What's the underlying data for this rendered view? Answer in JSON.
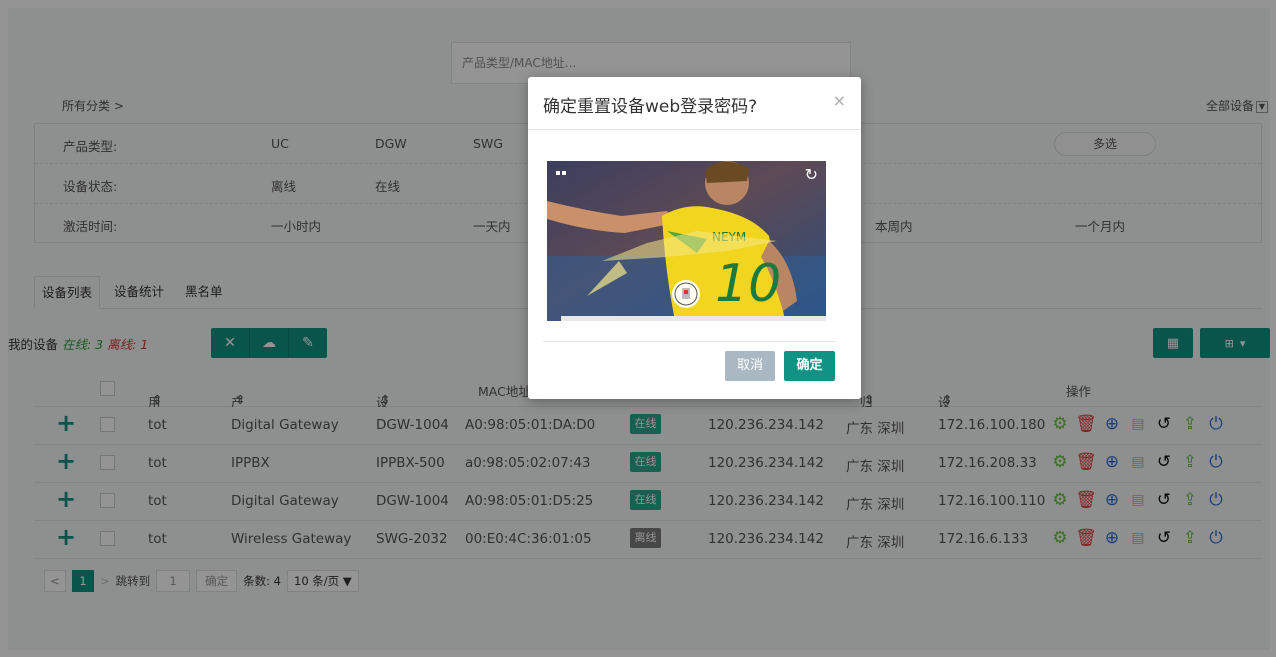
{
  "search": {
    "placeholder": "产品类型/MAC地址..."
  },
  "breadcrumb": {
    "label": "所有分类 >"
  },
  "device_scope": {
    "label": "全部设备"
  },
  "filters": {
    "product_type": {
      "label": "产品类型:",
      "options": [
        "UC",
        "DGW",
        "SWG"
      ],
      "multi_label": "多选"
    },
    "device_status": {
      "label": "设备状态:",
      "options": [
        "离线",
        "在线"
      ]
    },
    "activation_time": {
      "label": "激活时间:",
      "options": [
        "一小时内",
        "一天内",
        "本周内",
        "一个月内"
      ]
    }
  },
  "tabs": [
    "设备列表",
    "设备统计",
    "黑名单"
  ],
  "summary": {
    "label": "我的设备",
    "online_label": "在线: 3",
    "offline_label": "离线: 1"
  },
  "table": {
    "headers": [
      "用户ID",
      "产品类型",
      "设备型号",
      "MAC地址",
      "归属地",
      "设备IP",
      "操作"
    ],
    "rows": [
      {
        "user": "tot",
        "type": "Digital Gateway",
        "model": "DGW-1004",
        "mac": "A0:98:05:01:DA:D0",
        "status": "在线",
        "ip_public": "120.236.234.142",
        "region": "广东 深圳",
        "ip": "172.16.100.180"
      },
      {
        "user": "tot",
        "type": "IPPBX",
        "model": "IPPBX-500",
        "mac": "a0:98:05:02:07:43",
        "status": "在线",
        "ip_public": "120.236.234.142",
        "region": "广东 深圳",
        "ip": "172.16.208.33"
      },
      {
        "user": "tot",
        "type": "Digital Gateway",
        "model": "DGW-1004",
        "mac": "A0:98:05:01:D5:25",
        "status": "在线",
        "ip_public": "120.236.234.142",
        "region": "广东 深圳",
        "ip": "172.16.100.110"
      },
      {
        "user": "tot",
        "type": "Wireless Gateway",
        "model": "SWG-2032",
        "mac": "00:E0:4C:36:01:05",
        "status": "离线",
        "ip_public": "120.236.234.142",
        "region": "广东 深圳",
        "ip": "172.16.6.133"
      }
    ]
  },
  "pagination": {
    "current_page": "1",
    "goto_label": "跳转到",
    "goto_value": "1",
    "confirm_label": "确定",
    "count_label": "条数: 4",
    "page_size": "10 条/页 ▼"
  },
  "dialog": {
    "title": "确定重置设备web登录密码?",
    "close": "×",
    "cancel_label": "取消",
    "ok_label": "确定",
    "captcha_image_text": "NEYM",
    "captcha_number": "10"
  },
  "colors": {
    "accent": "#109384",
    "online": "#2aa58b",
    "offline": "#7a7a7a"
  }
}
